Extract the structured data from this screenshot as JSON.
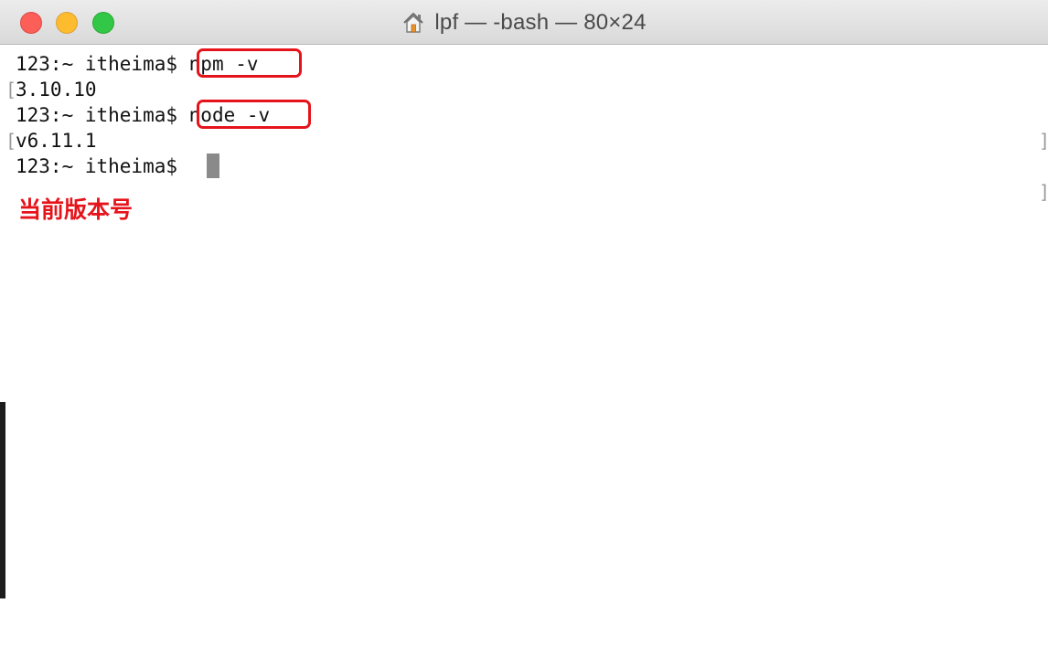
{
  "window": {
    "title": "lpf — -bash — 80×24",
    "title_icon": "home-icon",
    "buttons": {
      "close": "close-button",
      "minimize": "minimize-button",
      "zoom": "zoom-button"
    }
  },
  "terminal": {
    "lines": [
      {
        "prompt": "123:~ itheima$ ",
        "command": "npm -v",
        "bracketed": true
      },
      {
        "output": "3.10.10"
      },
      {
        "prompt": "123:~ itheima$ ",
        "command": "node -v",
        "bracketed": true
      },
      {
        "output": "v6.11.1"
      },
      {
        "prompt": "123:~ itheima$ ",
        "command": ""
      }
    ],
    "bracket_left": "[",
    "bracket_right": "]"
  },
  "annotation": {
    "text": "当前版本号",
    "color": "#e5141b"
  },
  "colors": {
    "highlight_box": "#e5141b",
    "close": "#fc5f57",
    "minimize": "#fdbc2e",
    "zoom": "#33c748"
  }
}
